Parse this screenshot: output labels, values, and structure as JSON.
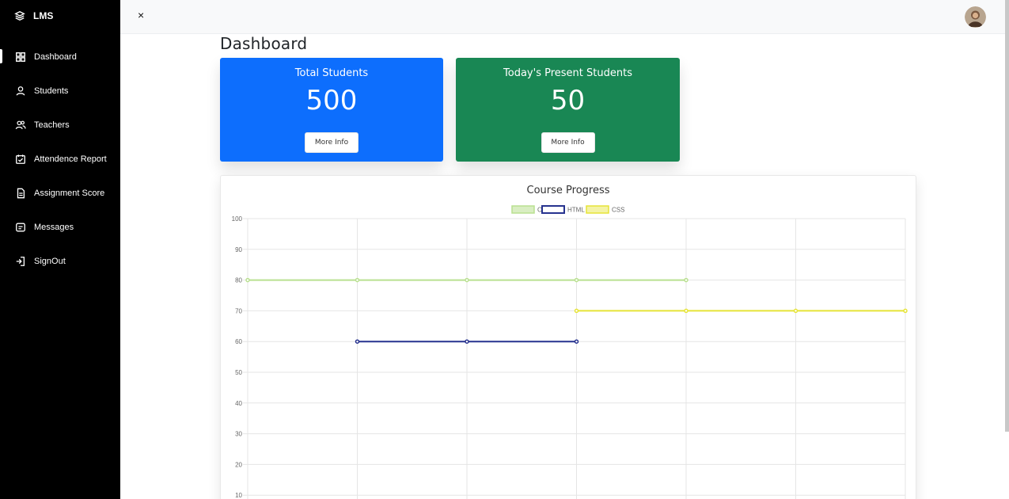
{
  "sidebar": {
    "brand": "LMS",
    "items": [
      {
        "label": "Dashboard",
        "icon": "dashboard-icon",
        "active": true
      },
      {
        "label": "Students",
        "icon": "user-icon"
      },
      {
        "label": "Teachers",
        "icon": "users-icon"
      },
      {
        "label": "Attendence Report",
        "icon": "calendar-check-icon"
      },
      {
        "label": "Assignment Score",
        "icon": "document-icon"
      },
      {
        "label": "Messages",
        "icon": "message-icon"
      },
      {
        "label": "SignOut",
        "icon": "signout-icon"
      }
    ]
  },
  "topbar": {
    "close_icon": "×"
  },
  "page": {
    "title": "Dashboard"
  },
  "cards": {
    "total": {
      "title": "Total Students",
      "value": "500",
      "button": "More Info",
      "color": "#0d6efd"
    },
    "present": {
      "title": "Today's Present Students",
      "value": "50",
      "button": "More Info",
      "color": "#198754"
    }
  },
  "chart_data": {
    "type": "line",
    "title": "Course Progress",
    "categories": [
      "",
      "",
      "",
      "",
      "",
      "",
      ""
    ],
    "ylim": [
      10,
      100
    ],
    "yticks": [
      100,
      90,
      80,
      70,
      60,
      50,
      40,
      30,
      20,
      10
    ],
    "grid": true,
    "legend": "top",
    "series": [
      {
        "name": "C",
        "color": "#b9e090",
        "values": [
          80,
          80,
          80,
          80,
          80,
          null,
          null
        ]
      },
      {
        "name": "HTML",
        "color": "#27338f",
        "values": [
          null,
          60,
          60,
          60,
          null,
          null,
          null
        ]
      },
      {
        "name": "CSS",
        "color": "#e6e438",
        "values": [
          null,
          null,
          null,
          70,
          70,
          70,
          70
        ]
      }
    ]
  }
}
